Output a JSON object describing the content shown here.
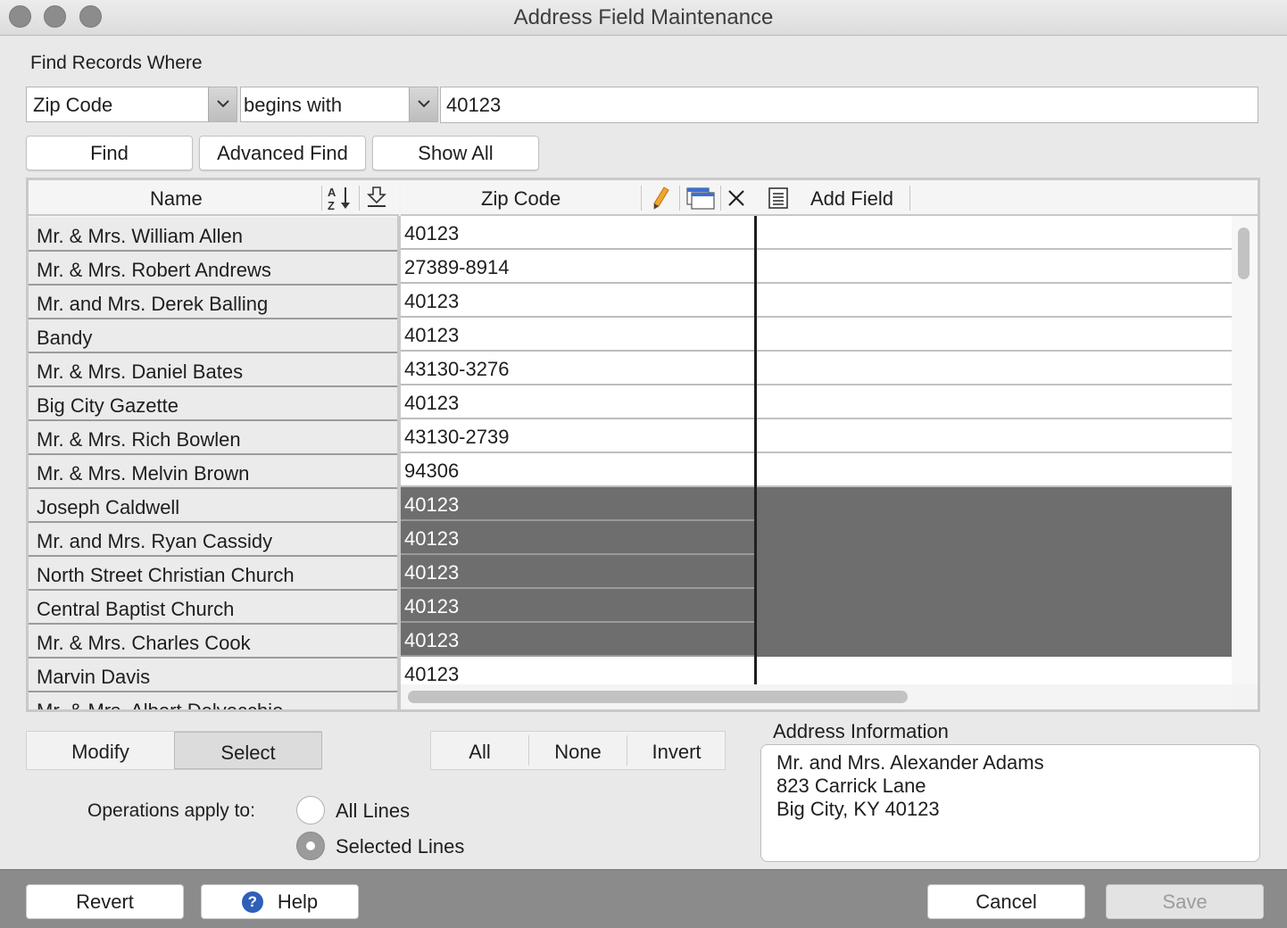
{
  "window": {
    "title": "Address Field Maintenance"
  },
  "find": {
    "label": "Find Records Where",
    "field_select": "Zip Code",
    "operator_select": "begins with",
    "value": "40123",
    "buttons": {
      "find": "Find",
      "advanced": "Advanced Find",
      "show_all": "Show All"
    }
  },
  "grid": {
    "columns": {
      "name": "Name",
      "zip": "Zip Code",
      "add_field": "Add Field"
    },
    "rows": [
      {
        "name": "Mr. & Mrs. William Allen",
        "zip": "40123",
        "selected": false
      },
      {
        "name": "Mr. & Mrs. Robert Andrews",
        "zip": "27389-8914",
        "selected": false
      },
      {
        "name": "Mr. and Mrs. Derek Balling",
        "zip": "40123",
        "selected": false
      },
      {
        "name": "Bandy",
        "zip": "40123",
        "selected": false
      },
      {
        "name": "Mr. & Mrs. Daniel Bates",
        "zip": "43130-3276",
        "selected": false
      },
      {
        "name": "Big City Gazette",
        "zip": "40123",
        "selected": false
      },
      {
        "name": "Mr. & Mrs. Rich Bowlen",
        "zip": "43130-2739",
        "selected": false
      },
      {
        "name": "Mr. & Mrs. Melvin Brown",
        "zip": "94306",
        "selected": false
      },
      {
        "name": "Joseph Caldwell",
        "zip": "40123",
        "selected": true
      },
      {
        "name": "Mr. and Mrs. Ryan Cassidy",
        "zip": "40123",
        "selected": true
      },
      {
        "name": "North Street Christian Church",
        "zip": "40123",
        "selected": true
      },
      {
        "name": "Central Baptist Church",
        "zip": "40123",
        "selected": true
      },
      {
        "name": "Mr. & Mrs. Charles Cook",
        "zip": "40123",
        "selected": true
      },
      {
        "name": "Marvin Davis",
        "zip": "40123",
        "selected": false
      },
      {
        "name": "Mr. & Mrs. Albert Delvecchio",
        "zip": "",
        "selected": false
      }
    ]
  },
  "mode": {
    "modify": "Modify",
    "select": "Select",
    "active": "Select"
  },
  "selection": {
    "all": "All",
    "none": "None",
    "invert": "Invert"
  },
  "operations": {
    "label": "Operations apply to:",
    "all_lines": "All Lines",
    "selected_lines": "Selected Lines",
    "selected": "Selected Lines"
  },
  "address": {
    "label": "Address Information",
    "lines": [
      "Mr. and Mrs. Alexander Adams",
      "823 Carrick Lane",
      "Big City, KY 40123"
    ]
  },
  "footer": {
    "revert": "Revert",
    "help": "Help",
    "cancel": "Cancel",
    "save": "Save"
  },
  "colors": {
    "selection": "#6e6e6e",
    "help_icon": "#2f5fb8"
  },
  "icons": [
    "sort-az-icon",
    "import-icon",
    "pencil-icon",
    "window-icon",
    "close-icon",
    "list-icon",
    "help-icon",
    "chevron-down-icon"
  ]
}
